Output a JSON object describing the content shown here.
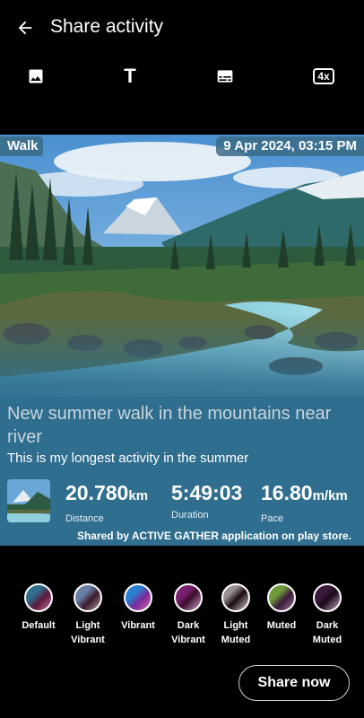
{
  "header": {
    "title": "Share activity",
    "back_icon": "arrow-back-icon"
  },
  "toolbar": {
    "image_icon": "image-icon",
    "text_icon": "text-format-icon",
    "text_glyph": "T",
    "subtitles_icon": "subtitles-icon",
    "scale_icon": "scale-4x-icon",
    "scale_label": "4x"
  },
  "card": {
    "activity_type": "Walk",
    "datetime": "9 Apr 2024, 03:15 PM",
    "headline": "New summer walk in the mountains near river",
    "subline": "This is my longest activity in the summer",
    "background_color": "#2f6e8e",
    "stats": [
      {
        "value": "20.780",
        "unit": "km",
        "label": "Distance"
      },
      {
        "value": "5:49:03",
        "unit": "",
        "label": "Duration"
      },
      {
        "value": "16.80",
        "unit": "m/km",
        "label": "Pace"
      }
    ],
    "shared_text": "Shared by ACTIVE GATHER application on play store."
  },
  "palettes": [
    {
      "label": "Default",
      "color_a": "#2f6e8e",
      "color_b": "#5b1a3a"
    },
    {
      "label": "Light Vibrant",
      "color_a": "#6a7fa8",
      "color_b": "#3b1a2a"
    },
    {
      "label": "Vibrant",
      "color_a": "#2a7fd0",
      "color_b": "#7a2a9a"
    },
    {
      "label": "Dark Vibrant",
      "color_a": "#7a1f6e",
      "color_b": "#b07ab0"
    },
    {
      "label": "Light Muted",
      "color_a": "#9a8f93",
      "color_b": "#2a0f1a"
    },
    {
      "label": "Muted",
      "color_a": "#6f9a3a",
      "color_b": "#3a1a3a"
    },
    {
      "label": "Dark Muted",
      "color_a": "#3a1a3a",
      "color_b": "#b09ab0"
    }
  ],
  "actions": {
    "share_label": "Share now"
  }
}
